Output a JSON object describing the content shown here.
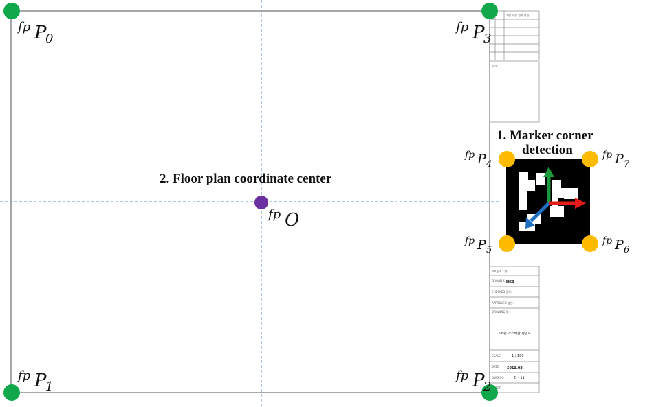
{
  "colors": {
    "corner_point": "#10a84a",
    "marker_corner": "#ffbb00",
    "center_point": "#6a2fa0",
    "axis_x": "#e31b1b",
    "axis_y": "#1a9a3c",
    "axis_z": "#1f6ec2",
    "guide_line": "#5b8fc2",
    "frame_line": "#6e6e6e"
  },
  "labels": {
    "step1_line1": "1. Marker  corner",
    "step1_line2": "detection",
    "step2": "2. Floor plan coordinate  center",
    "prefix": "fp",
    "p0": "P",
    "p0_sub": "0",
    "p1": "P",
    "p1_sub": "1",
    "p2": "P",
    "p2_sub": "2",
    "p3": "P",
    "p3_sub": "3",
    "p4": "P",
    "p4_sub": "4",
    "p5": "P",
    "p5_sub": "5",
    "p6": "P",
    "p6_sub": "6",
    "p7": "P",
    "p7_sub": "7",
    "origin": "O"
  },
  "title_block": {
    "project_label": "PROJECT 명:",
    "field1_label": "DRAWN 작성:",
    "field1_value": "HKS",
    "field2_label": "CHECKED 검토:",
    "field3_label": "APPROVED 승인:",
    "field4_label": "DRAWING 명:",
    "drawing_title": "2-6층 가스배관 평면도",
    "scale_label": "SCALE",
    "scale_value": "1 / 100",
    "date_label": "DATE",
    "date_value": "2012.05.",
    "number_label": "DWG NO.",
    "number_value": "B - 11",
    "sheet_label": "SHEET",
    "top_header": "개정 내용 일자 확인",
    "note_label": "비고:"
  }
}
